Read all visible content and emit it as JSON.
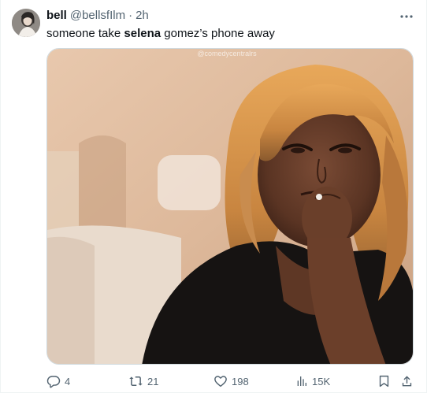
{
  "tweet": {
    "author_name": "bell",
    "author_handle": "@bellsfIlm",
    "separator": "·",
    "time": "2h",
    "text_before": "someone take ",
    "text_bold": "selena",
    "text_after": " gomez’s phone away",
    "image_watermark": "@comedycentralrs"
  },
  "actions": {
    "replies": "4",
    "retweets": "21",
    "likes": "198",
    "views": "15K"
  },
  "icons": {
    "more": "more-dots-icon",
    "reply": "reply-icon",
    "retweet": "retweet-icon",
    "like": "heart-icon",
    "views": "views-icon",
    "bookmark": "bookmark-icon",
    "share": "share-icon"
  },
  "colors": {
    "text": "#0f1419",
    "secondary": "#536471",
    "border": "#cfd9de"
  }
}
